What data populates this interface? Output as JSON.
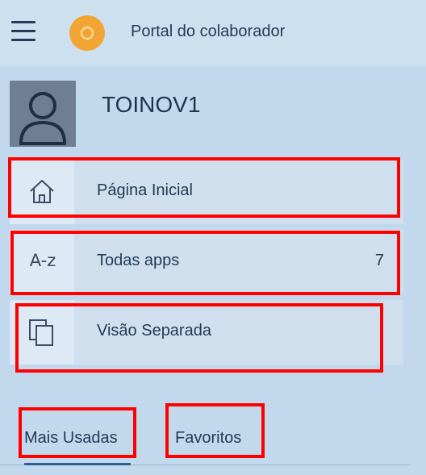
{
  "header": {
    "title": "Portal do colaborador",
    "menu_icon": "hamburger-menu-icon",
    "logo_icon": "circle-logo-icon",
    "logo_color": "#f2a533"
  },
  "user": {
    "name": "TOINOV1",
    "avatar_icon": "user-avatar-icon"
  },
  "nav": [
    {
      "label": "Página Inicial",
      "icon": "home-icon",
      "count": ""
    },
    {
      "label": "Todas apps",
      "icon": "a-z-icon",
      "icon_text": "A-z",
      "count": "7"
    },
    {
      "label": "Visão Separada",
      "icon": "copy-windows-icon",
      "count": ""
    }
  ],
  "tabs": [
    {
      "label": "Mais Usadas",
      "selected": true
    },
    {
      "label": "Favoritos",
      "selected": false
    }
  ],
  "colors": {
    "highlight": "#ff0000",
    "panel": "#c2d8ec",
    "text": "#1f3b57"
  }
}
